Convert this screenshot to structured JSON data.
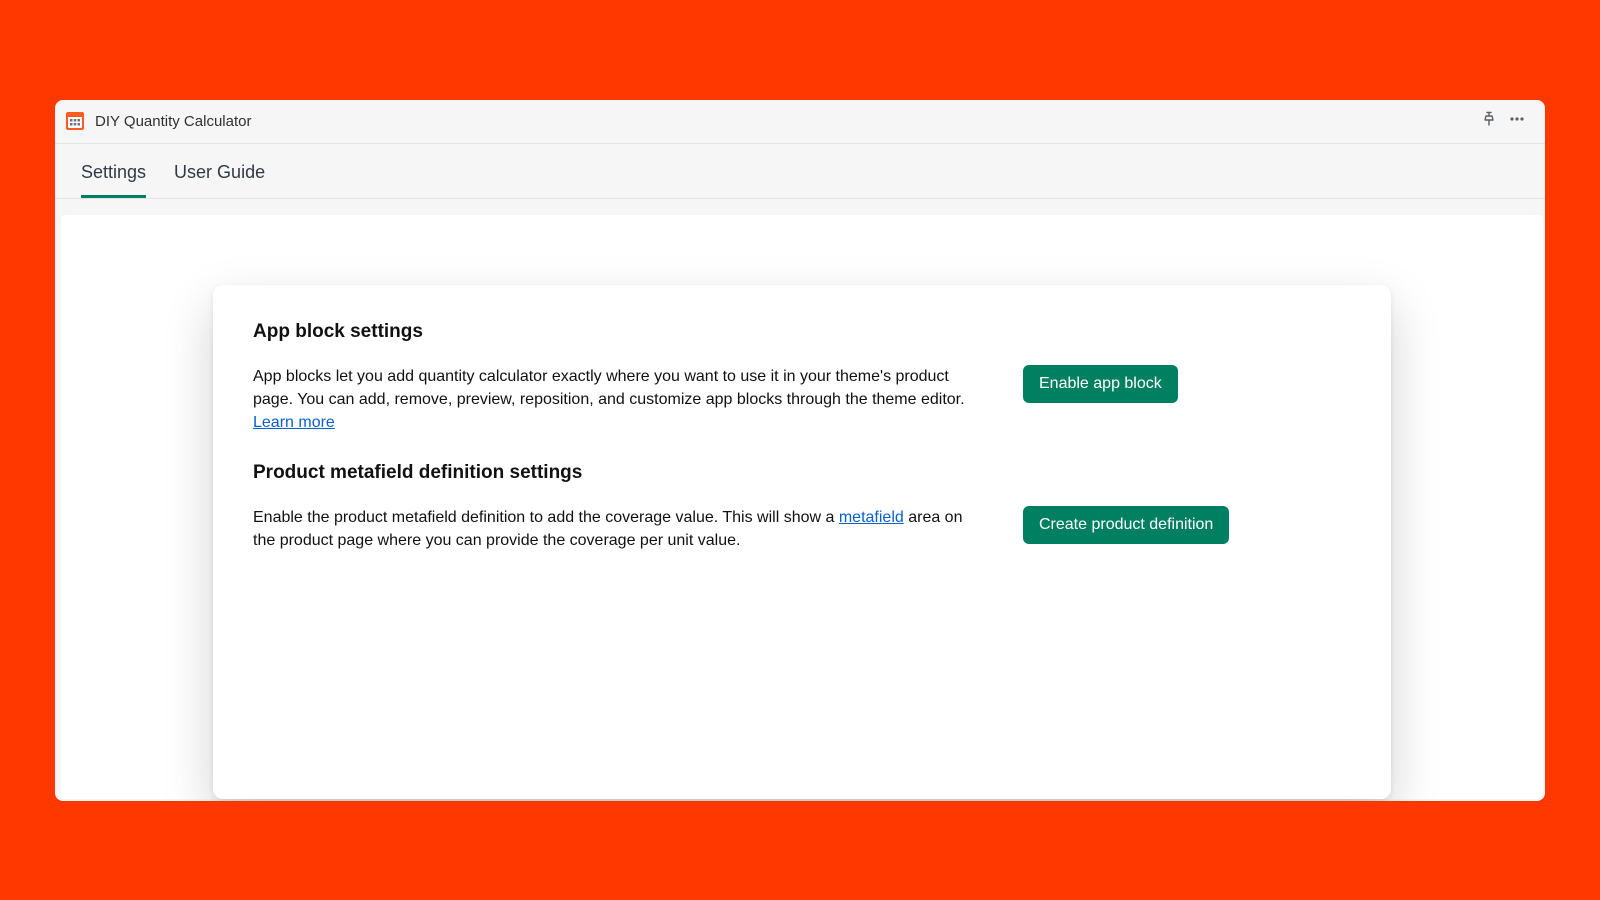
{
  "header": {
    "app_title": "DIY Quantity Calculator"
  },
  "tabs": {
    "settings": "Settings",
    "user_guide": "User Guide"
  },
  "card": {
    "section1": {
      "title": "App block settings",
      "text_before_link": "App blocks let you add quantity calculator exactly where you want to use it in your theme's product page. You can add, remove, preview, reposition, and customize app blocks through the theme editor. ",
      "link_text": "Learn more",
      "text_after_link": "",
      "button": "Enable app block"
    },
    "section2": {
      "title": "Product metafield definition settings",
      "text_before_link": "Enable the product metafield definition to add the coverage value. This will show a ",
      "link_text": "metafield",
      "text_after_link": " area on the product page where you can provide the coverage per unit value.",
      "button": "Create product definition"
    }
  },
  "colors": {
    "background": "#ff3800",
    "primary_button": "#008060",
    "link": "#0a5fd1"
  }
}
